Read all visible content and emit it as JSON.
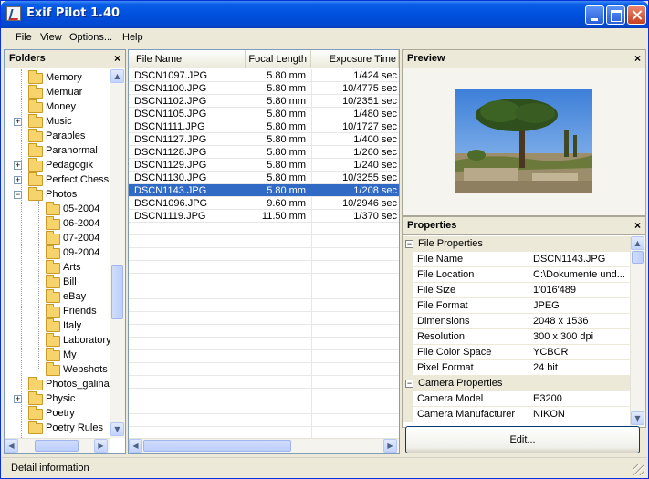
{
  "window": {
    "title": "Exif Pilot 1.40"
  },
  "menu": {
    "items": [
      "File",
      "View",
      "Options...",
      "Help"
    ]
  },
  "folders_panel": {
    "title": "Folders",
    "close": "×",
    "items": [
      {
        "label": "Memory",
        "level": 1,
        "expander": ""
      },
      {
        "label": "Memuar",
        "level": 1,
        "expander": ""
      },
      {
        "label": "Money",
        "level": 1,
        "expander": ""
      },
      {
        "label": "Music",
        "level": 1,
        "expander": "+"
      },
      {
        "label": "Parables",
        "level": 1,
        "expander": ""
      },
      {
        "label": "Paranormal",
        "level": 1,
        "expander": ""
      },
      {
        "label": "Pedagogik",
        "level": 1,
        "expander": "+"
      },
      {
        "label": "Perfect Chess",
        "level": 1,
        "expander": "+"
      },
      {
        "label": "Photos",
        "level": 1,
        "expander": "−"
      },
      {
        "label": "05-2004",
        "level": 2,
        "expander": ""
      },
      {
        "label": "06-2004",
        "level": 2,
        "expander": ""
      },
      {
        "label": "07-2004",
        "level": 2,
        "expander": ""
      },
      {
        "label": "09-2004",
        "level": 2,
        "expander": ""
      },
      {
        "label": "Arts",
        "level": 2,
        "expander": ""
      },
      {
        "label": "Bill",
        "level": 2,
        "expander": ""
      },
      {
        "label": "eBay",
        "level": 2,
        "expander": ""
      },
      {
        "label": "Friends",
        "level": 2,
        "expander": ""
      },
      {
        "label": "Italy",
        "level": 2,
        "expander": ""
      },
      {
        "label": "Laboratory",
        "level": 2,
        "expander": ""
      },
      {
        "label": "My",
        "level": 2,
        "expander": ""
      },
      {
        "label": "Webshots",
        "level": 2,
        "expander": ""
      },
      {
        "label": "Photos_galina",
        "level": 1,
        "expander": ""
      },
      {
        "label": "Physic",
        "level": 1,
        "expander": "+"
      },
      {
        "label": "Poetry",
        "level": 1,
        "expander": ""
      },
      {
        "label": "Poetry Rules",
        "level": 1,
        "expander": ""
      }
    ]
  },
  "file_list": {
    "columns": [
      "File Name",
      "Focal Length",
      "Exposure Time"
    ],
    "selected_index": 9,
    "rows": [
      [
        "DSCN1097.JPG",
        "5.80 mm",
        "1/424 sec"
      ],
      [
        "DSCN1100.JPG",
        "5.80 mm",
        "10/4775 sec"
      ],
      [
        "DSCN1102.JPG",
        "5.80 mm",
        "10/2351 sec"
      ],
      [
        "DSCN1105.JPG",
        "5.80 mm",
        "1/480 sec"
      ],
      [
        "DSCN1111.JPG",
        "5.80 mm",
        "10/1727 sec"
      ],
      [
        "DSCN1127.JPG",
        "5.80 mm",
        "1/400 sec"
      ],
      [
        "DSCN1128.JPG",
        "5.80 mm",
        "1/260 sec"
      ],
      [
        "DSCN1129.JPG",
        "5.80 mm",
        "1/240 sec"
      ],
      [
        "DSCN1130.JPG",
        "5.80 mm",
        "10/3255 sec"
      ],
      [
        "DSCN1143.JPG",
        "5.80 mm",
        "1/208 sec"
      ],
      [
        "DSCN1096.JPG",
        "9.60 mm",
        "10/2946 sec"
      ],
      [
        "DSCN1119.JPG",
        "11.50 mm",
        "1/370 sec"
      ]
    ]
  },
  "preview_panel": {
    "title": "Preview",
    "close": "×"
  },
  "properties_panel": {
    "title": "Properties",
    "close": "×",
    "categories": [
      {
        "label": "File Properties",
        "expander": "−",
        "rows": [
          [
            "File Name",
            "DSCN1143.JPG"
          ],
          [
            "File Location",
            "C:\\Dokumente und..."
          ],
          [
            "File Size",
            "1'016'489"
          ],
          [
            "File Format",
            "JPEG"
          ],
          [
            "Dimensions",
            "2048 x 1536"
          ],
          [
            "Resolution",
            "300 x 300 dpi"
          ],
          [
            "File Color Space",
            "YCBCR"
          ],
          [
            "Pixel Format",
            "24 bit"
          ]
        ]
      },
      {
        "label": "Camera Properties",
        "expander": "−",
        "rows": [
          [
            "Camera Model",
            "E3200"
          ],
          [
            "Camera Manufacturer",
            "NIKON"
          ]
        ]
      }
    ]
  },
  "edit_button": {
    "label": "Edit..."
  },
  "status_bar": {
    "text": "Detail information"
  },
  "colors": {
    "title_bar": "#0050de",
    "selection": "#316ac5",
    "panel_bg": "#ece9d8"
  }
}
